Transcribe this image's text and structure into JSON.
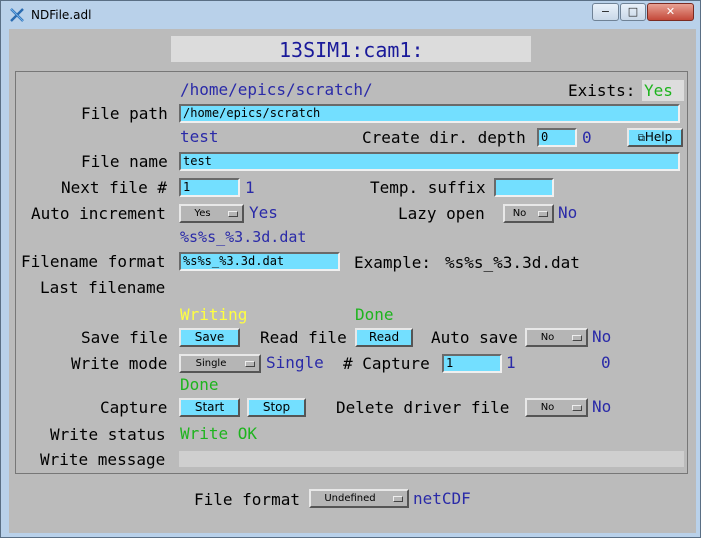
{
  "window": {
    "title": "NDFile.adl",
    "minimize": "−",
    "maximize": "□",
    "close": "✕"
  },
  "header": {
    "prefix": "13SIM1:cam1:"
  },
  "file_path": {
    "readback": "/home/epics/scratch/",
    "exists_label": "Exists:",
    "exists_value": "Yes",
    "label": "File path",
    "value": "/home/epics/scratch"
  },
  "file_name": {
    "readback": "test",
    "label": "File name",
    "value": "test"
  },
  "create_dir": {
    "label": "Create dir. depth",
    "value": "0",
    "readback": "0"
  },
  "help": {
    "label": "Help"
  },
  "next_file": {
    "label": "Next file #",
    "value": "1",
    "readback": "1"
  },
  "temp_suffix": {
    "label": "Temp. suffix",
    "value": ""
  },
  "auto_increment": {
    "label": "Auto increment",
    "menu": "Yes",
    "readback": "Yes"
  },
  "lazy_open": {
    "label": "Lazy open",
    "menu": "No",
    "readback": "No"
  },
  "filename_format": {
    "readback": "%s%s_%3.3d.dat",
    "label": "Filename format",
    "value": "%s%s_%3.3d.dat",
    "example_label": "Example:",
    "example_value": "%s%s_%3.3d.dat"
  },
  "last_filename": {
    "label": "Last filename",
    "value": ""
  },
  "save_file": {
    "status": "Writing",
    "label": "Save file",
    "button": "Save"
  },
  "read_file": {
    "status": "Done",
    "label": "Read file",
    "button": "Read"
  },
  "auto_save": {
    "label": "Auto save",
    "menu": "No",
    "readback": "No"
  },
  "write_mode": {
    "label": "Write mode",
    "menu": "Single",
    "readback": "Single"
  },
  "num_capture": {
    "label": "# Capture",
    "value": "1",
    "readback": "1",
    "captured": "0"
  },
  "capture": {
    "status": "Done",
    "label": "Capture",
    "start": "Start",
    "stop": "Stop"
  },
  "delete_driver_file": {
    "label": "Delete driver file",
    "menu": "No",
    "readback": "No"
  },
  "write_status": {
    "label": "Write status",
    "value": "Write OK"
  },
  "write_message": {
    "label": "Write message",
    "value": ""
  },
  "file_format": {
    "label": "File format",
    "menu": "Undefined",
    "readback": "netCDF"
  }
}
